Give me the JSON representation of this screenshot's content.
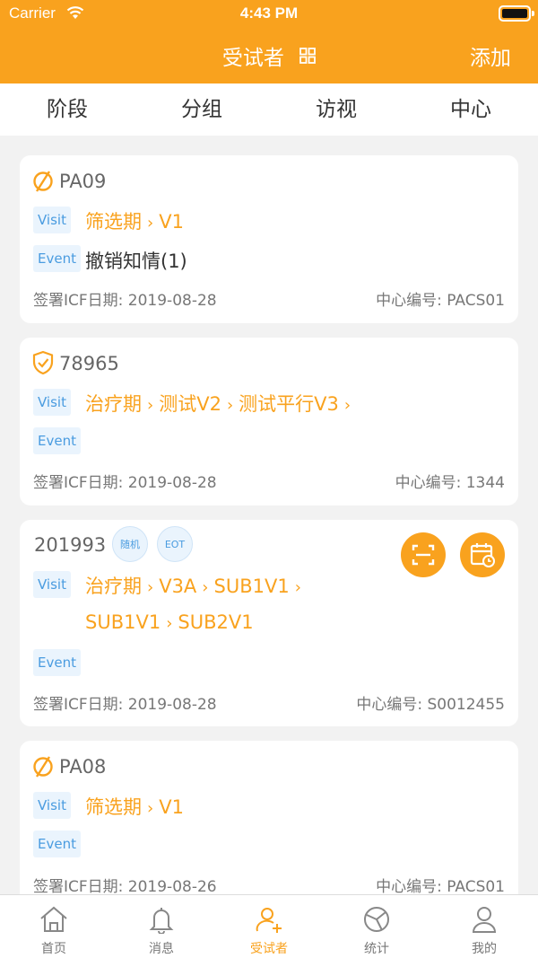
{
  "status": {
    "carrier": "Carrier",
    "time": "4:43 PM"
  },
  "nav": {
    "title": "受试者",
    "add": "添加"
  },
  "filters": [
    "阶段",
    "分组",
    "访视",
    "中心"
  ],
  "labels": {
    "visit": "Visit",
    "event": "Event"
  },
  "cards": [
    {
      "id": "PA09",
      "path": [
        "筛选期",
        "V1"
      ],
      "event": "撤销知情(1)",
      "icf": "签署ICF日期: 2019-08-28",
      "center": "中心编号: PACS01"
    },
    {
      "id": "78965",
      "path": [
        "治疗期",
        "测试V2",
        "测试平行V3"
      ],
      "event": "",
      "icf": "签署ICF日期: 2019-08-28",
      "center": "中心编号: 1344"
    },
    {
      "id": "201993",
      "badges": [
        "随机",
        "EOT"
      ],
      "path_line1": [
        "治疗期",
        "V3A",
        "SUB1V1"
      ],
      "path_line2": [
        "SUB1V1",
        "SUB2V1"
      ],
      "event": "",
      "icf": "签署ICF日期: 2019-08-28",
      "center": "中心编号: S0012455"
    },
    {
      "id": "PA08",
      "path": [
        "筛选期",
        "V1"
      ],
      "event": "",
      "icf": "签署ICF日期: 2019-08-26",
      "center": "中心编号: PACS01"
    }
  ],
  "tabs": [
    {
      "label": "首页",
      "icon": "home-icon"
    },
    {
      "label": "消息",
      "icon": "bell-icon"
    },
    {
      "label": "受试者",
      "icon": "add-user-icon",
      "active": true
    },
    {
      "label": "统计",
      "icon": "pie-chart-icon"
    },
    {
      "label": "我的",
      "icon": "person-icon"
    }
  ],
  "colors": {
    "brand": "#F9A21E",
    "tag_bg": "#EAF4FD",
    "tag_text": "#4A9CE0"
  }
}
